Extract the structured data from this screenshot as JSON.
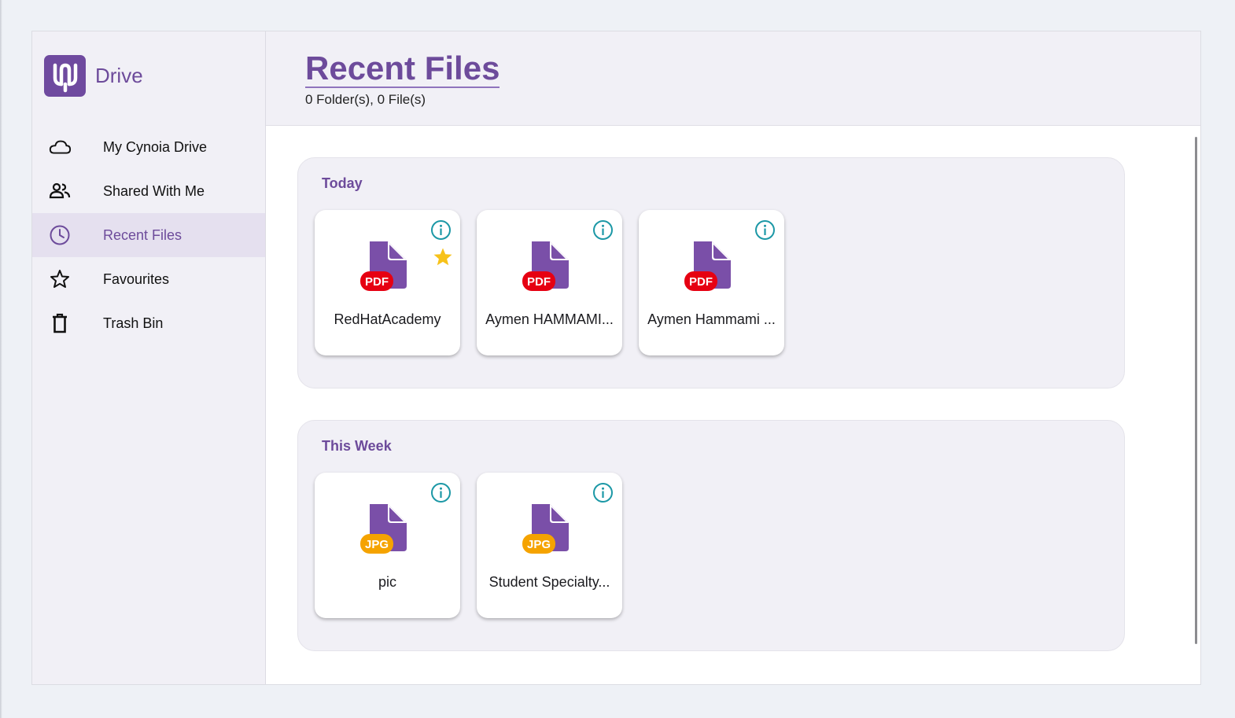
{
  "app": {
    "name": "Drive"
  },
  "sidebar": {
    "items": [
      {
        "label": "My Cynoia Drive",
        "icon": "cloud-icon"
      },
      {
        "label": "Shared With Me",
        "icon": "people-icon"
      },
      {
        "label": "Recent Files",
        "icon": "clock-icon",
        "active": true
      },
      {
        "label": "Favourites",
        "icon": "star-outline-icon"
      },
      {
        "label": "Trash Bin",
        "icon": "trash-icon"
      }
    ]
  },
  "header": {
    "title": "Recent Files",
    "subtitle": "0 Folder(s), 0 File(s)"
  },
  "colors": {
    "accent": "#6d4b9b",
    "file_icon": "#7a4fa8",
    "pdf_badge": "#e60012",
    "jpg_badge": "#f5a300",
    "info_icon": "#1c98a6",
    "star": "#f7c21a"
  },
  "sections": [
    {
      "title": "Today",
      "files": [
        {
          "name": "RedHatAcademy",
          "type": "PDF",
          "favourite": true
        },
        {
          "name": "Aymen HAMMAMI...",
          "type": "PDF",
          "favourite": false
        },
        {
          "name": "Aymen Hammami ...",
          "type": "PDF",
          "favourite": false
        }
      ]
    },
    {
      "title": "This Week",
      "files": [
        {
          "name": "pic",
          "type": "JPG",
          "favourite": false
        },
        {
          "name": "Student Specialty...",
          "type": "JPG",
          "favourite": false
        }
      ]
    }
  ]
}
